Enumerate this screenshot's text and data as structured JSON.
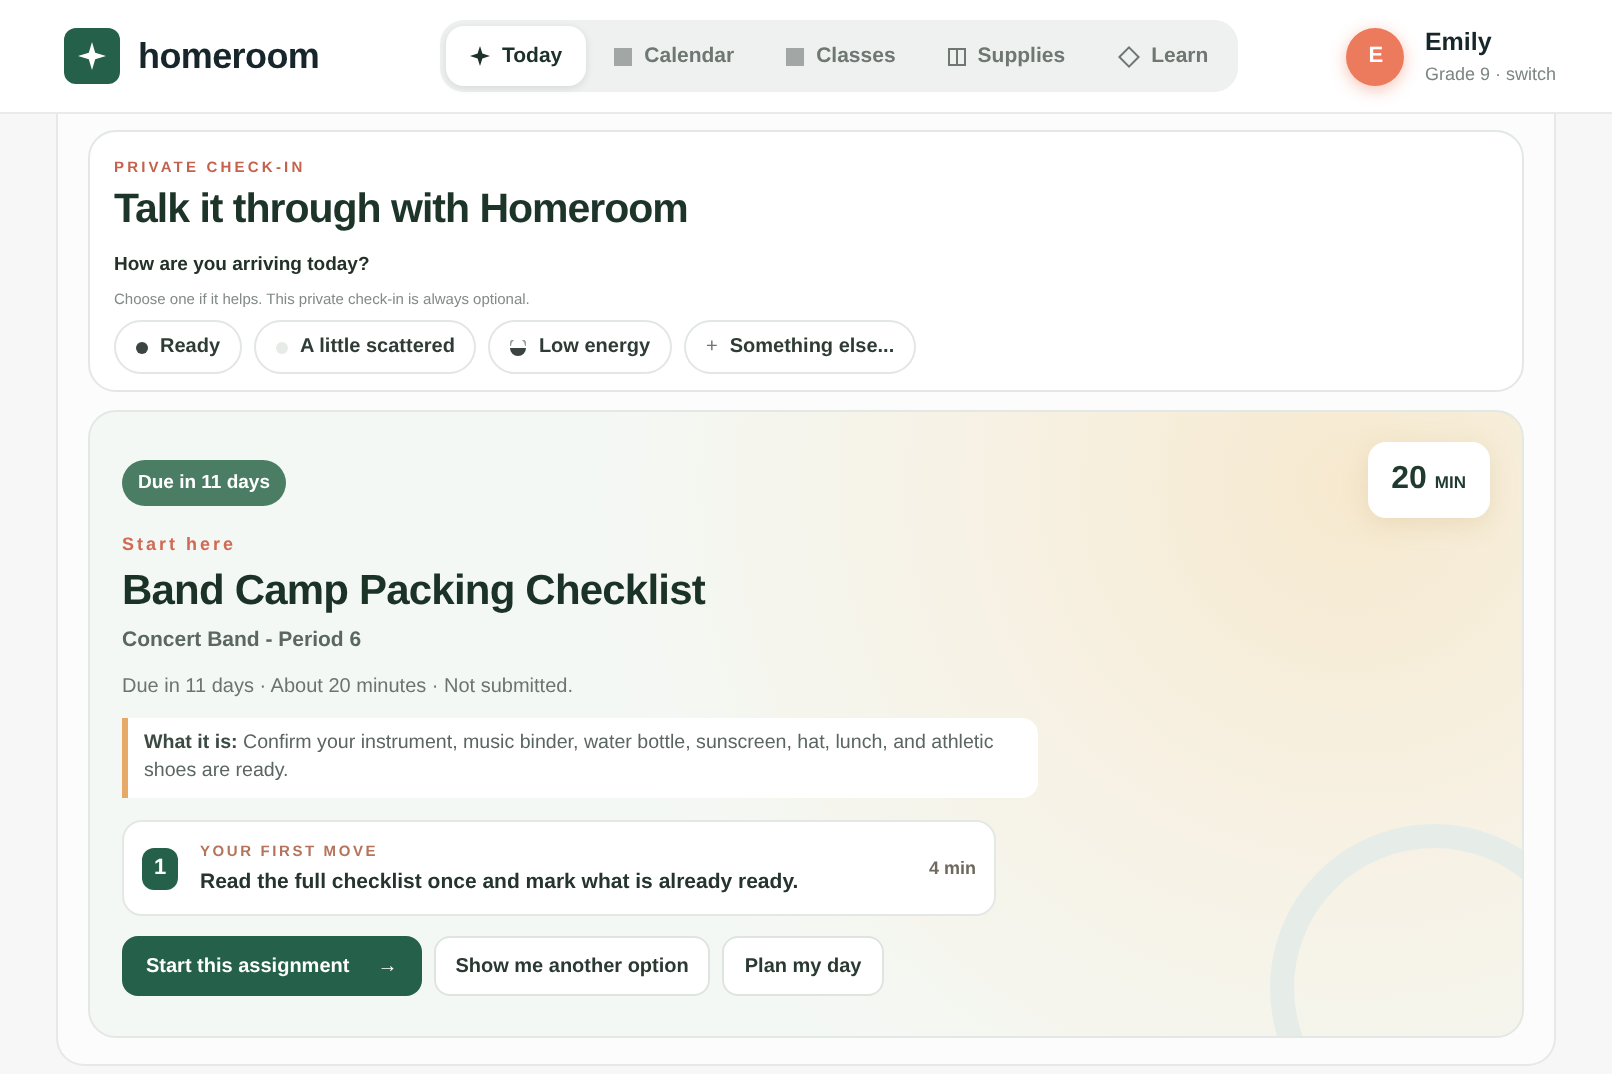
{
  "brand": {
    "name": "homeroom"
  },
  "nav": [
    {
      "label": "Today",
      "selected": true
    },
    {
      "label": "Calendar",
      "selected": false
    },
    {
      "label": "Classes",
      "selected": false
    },
    {
      "label": "Supplies",
      "selected": false
    },
    {
      "label": "Learn",
      "selected": false
    }
  ],
  "user": {
    "initial": "E",
    "name": "Emily",
    "detail": "Grade 9 · switch"
  },
  "checkin": {
    "eyebrow": "PRIVATE CHECK-IN",
    "title": "Talk it through with Homeroom",
    "question": "How are you arriving today?",
    "hint": "Choose one if it helps. This private check-in is always optional.",
    "options": [
      {
        "label": "Ready"
      },
      {
        "label": "A little scattered"
      },
      {
        "label": "Low energy"
      },
      {
        "label": "Something else...",
        "symbol": "+"
      }
    ]
  },
  "assignment": {
    "badge": "Due in 11 days",
    "duration": {
      "value": "20",
      "unit": "MIN"
    },
    "eyebrow": "Start here",
    "title": "Band Camp Packing Checklist",
    "course": "Concert Band - Period 6",
    "meta": "Due in 11 days · About 20 minutes · Not submitted.",
    "description": "**What it is:** Confirm your instrument, music binder, water bottle, sunscreen, hat, lunch, and athletic shoes are ready.",
    "first_move": {
      "step": "1",
      "label": "YOUR FIRST MOVE",
      "text": "Read the full checklist once and mark what is already ready.",
      "time": "4 min"
    },
    "actions": [
      {
        "label": "Start this assignment",
        "kind": "primary",
        "arrow": "→"
      },
      {
        "label": "Show me another option",
        "kind": "secondary"
      },
      {
        "label": "Plan my day",
        "kind": "secondary"
      }
    ]
  }
}
